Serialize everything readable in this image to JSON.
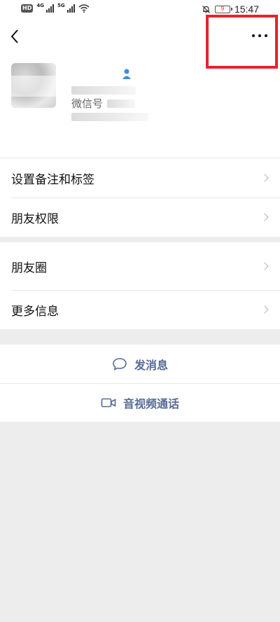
{
  "status_bar": {
    "hd_badge": "HD",
    "network_1": "4G",
    "network_2": "5G",
    "battery": "9",
    "time": "15:47"
  },
  "profile": {
    "wechat_id_label": "微信号"
  },
  "settings": {
    "remark_tags": "设置备注和标签",
    "friend_permissions": "朋友权限"
  },
  "social": {
    "moments": "朋友圈",
    "more_info": "更多信息"
  },
  "actions": {
    "send_message": "发消息",
    "video_call": "音视频通话"
  },
  "colors": {
    "link": "#576b95",
    "highlight_box": "#e6242b",
    "gender_icon": "#3f8fd8"
  }
}
